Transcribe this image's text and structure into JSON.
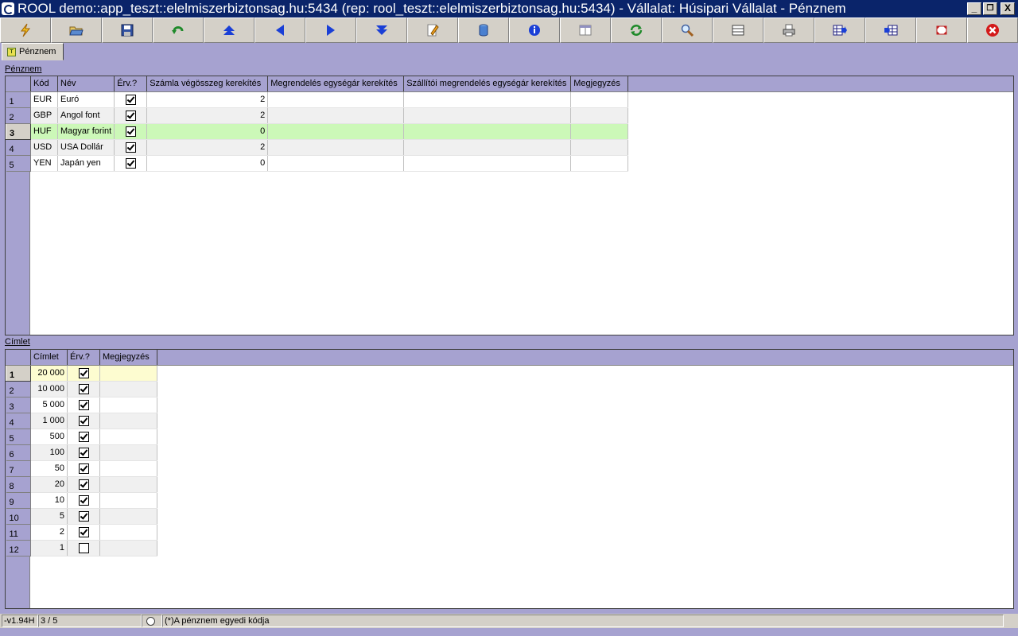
{
  "window": {
    "title": "ROOL demo::app_teszt::elelmiszerbiztonsag.hu:5434 (rep: rool_teszt::elelmiszerbiztonsag.hu:5434) - Vállalat: Húsipari Vállalat - Pénznem",
    "minimize": "_",
    "restore": "❐",
    "close": "X"
  },
  "toolbar": {
    "buttons": [
      {
        "name": "lightning-icon"
      },
      {
        "name": "open-folder-icon"
      },
      {
        "name": "save-disk-icon"
      },
      {
        "name": "undo-arrow-icon"
      },
      {
        "name": "first-record-icon"
      },
      {
        "name": "prev-record-icon"
      },
      {
        "name": "next-record-icon"
      },
      {
        "name": "last-record-icon"
      },
      {
        "name": "edit-pencil-icon"
      },
      {
        "name": "database-icon"
      },
      {
        "name": "info-icon"
      },
      {
        "name": "form-view-icon"
      },
      {
        "name": "refresh-icon"
      },
      {
        "name": "search-icon"
      },
      {
        "name": "grid-lines-icon"
      },
      {
        "name": "print-icon"
      },
      {
        "name": "export-grid-icon"
      },
      {
        "name": "import-grid-icon"
      },
      {
        "name": "fullscreen-icon"
      },
      {
        "name": "close-icon"
      }
    ],
    "colors": {
      "blue": "#1a3fd6",
      "green": "#1f8a2a",
      "red": "#d31a1a"
    }
  },
  "tab": {
    "label": "Pénznem"
  },
  "penznem": {
    "section_label": "Pénznem",
    "columns": [
      "Kód",
      "Név",
      "Érv.?",
      "Számla végösszeg kerekítés",
      "Megrendelés egységár kerekítés",
      "Szállítói megrendelés egységár kerekítés",
      "Megjegyzés"
    ],
    "rows": [
      {
        "n": "1",
        "kod": "EUR",
        "nev": "Euró",
        "erv": true,
        "szamla": "2",
        "megr": "",
        "szall": "",
        "megj": ""
      },
      {
        "n": "2",
        "kod": "GBP",
        "nev": "Angol font",
        "erv": true,
        "szamla": "2",
        "megr": "",
        "szall": "",
        "megj": ""
      },
      {
        "n": "3",
        "kod": "HUF",
        "nev": "Magyar forint",
        "erv": true,
        "szamla": "0",
        "megr": "",
        "szall": "",
        "megj": ""
      },
      {
        "n": "4",
        "kod": "USD",
        "nev": "USA Dollár",
        "erv": true,
        "szamla": "2",
        "megr": "",
        "szall": "",
        "megj": ""
      },
      {
        "n": "5",
        "kod": "YEN",
        "nev": "Japán yen",
        "erv": true,
        "szamla": "0",
        "megr": "",
        "szall": "",
        "megj": ""
      }
    ],
    "selected_row": 3,
    "selected_color": "#ccf8b8"
  },
  "cimlet": {
    "section_label": "Címlet",
    "columns": [
      "Címlet",
      "Érv.?",
      "Megjegyzés"
    ],
    "rows": [
      {
        "n": "1",
        "cimlet": "20 000",
        "erv": true,
        "megj": ""
      },
      {
        "n": "2",
        "cimlet": "10 000",
        "erv": true,
        "megj": ""
      },
      {
        "n": "3",
        "cimlet": "5 000",
        "erv": true,
        "megj": ""
      },
      {
        "n": "4",
        "cimlet": "1 000",
        "erv": true,
        "megj": ""
      },
      {
        "n": "5",
        "cimlet": "500",
        "erv": true,
        "megj": ""
      },
      {
        "n": "6",
        "cimlet": "100",
        "erv": true,
        "megj": ""
      },
      {
        "n": "7",
        "cimlet": "50",
        "erv": true,
        "megj": ""
      },
      {
        "n": "8",
        "cimlet": "20",
        "erv": true,
        "megj": ""
      },
      {
        "n": "9",
        "cimlet": "10",
        "erv": true,
        "megj": ""
      },
      {
        "n": "10",
        "cimlet": "5",
        "erv": true,
        "megj": ""
      },
      {
        "n": "11",
        "cimlet": "2",
        "erv": true,
        "megj": ""
      },
      {
        "n": "12",
        "cimlet": "1",
        "erv": false,
        "megj": ""
      }
    ],
    "current_row": 1,
    "current_color": "#fdfcd0"
  },
  "status": {
    "version": "-v1.94H",
    "position": "3 / 5",
    "hint": "(*)A pénznem egyedi kódja"
  }
}
